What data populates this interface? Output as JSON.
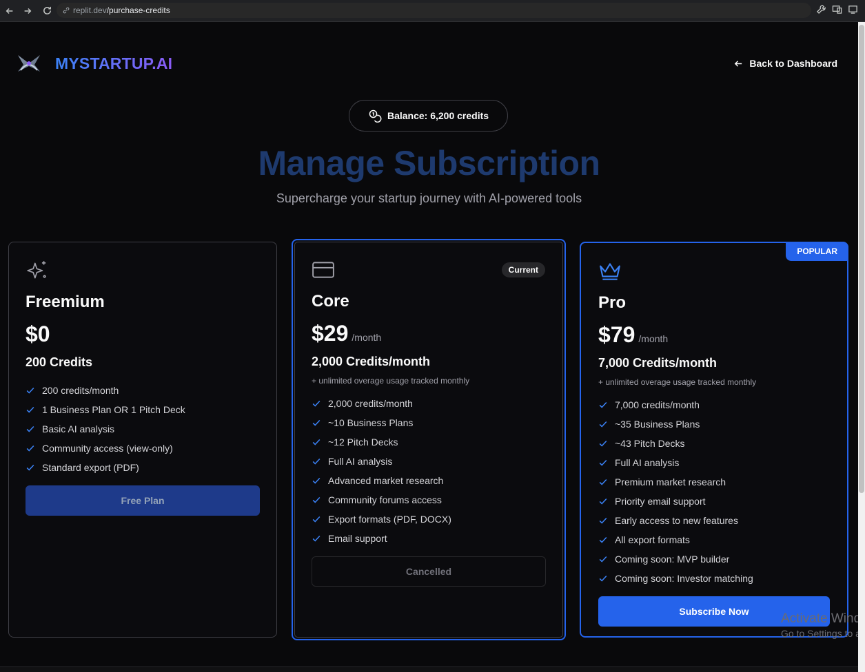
{
  "browser": {
    "url_host": "replit.dev",
    "url_path": "/purchase-credits"
  },
  "header": {
    "logo_text": "MYSTARTUP.AI",
    "back_label": "Back to Dashboard"
  },
  "balance": {
    "label": "Balance: 6,200 credits"
  },
  "hero": {
    "title": "Manage Subscription",
    "subtitle": "Supercharge your startup journey with AI-powered tools"
  },
  "plans": [
    {
      "name": "Freemium",
      "icon": "sparkles-icon",
      "price": "$0",
      "period": "",
      "credits": "200 Credits",
      "overage": "",
      "features": [
        "200 credits/month",
        "1 Business Plan OR 1 Pitch Deck",
        "Basic AI analysis",
        "Community access (view-only)",
        "Standard export (PDF)"
      ],
      "button": "Free Plan"
    },
    {
      "name": "Core",
      "icon": "credit-card-icon",
      "badge": "Current",
      "price": "$29",
      "period": "/month",
      "credits": "2,000 Credits/month",
      "overage": "+ unlimited overage usage tracked monthly",
      "features": [
        "2,000 credits/month",
        "~10 Business Plans",
        "~12 Pitch Decks",
        "Full AI analysis",
        "Advanced market research",
        "Community forums access",
        "Export formats (PDF, DOCX)",
        "Email support"
      ],
      "button": "Cancelled"
    },
    {
      "name": "Pro",
      "icon": "crown-icon",
      "badge": "POPULAR",
      "price": "$79",
      "period": "/month",
      "credits": "7,000 Credits/month",
      "overage": "+ unlimited overage usage tracked monthly",
      "features": [
        "7,000 credits/month",
        "~35 Business Plans",
        "~43 Pitch Decks",
        "Full AI analysis",
        "Premium market research",
        "Priority email support",
        "Early access to new features",
        "All export formats",
        "Coming soon: MVP builder",
        "Coming soon: Investor matching"
      ],
      "button": "Subscribe Now"
    }
  ],
  "watermark": {
    "title": "Activate Windows",
    "subtitle": "Go to Settings to activate Windows."
  },
  "colors": {
    "background": "#09090b",
    "accent": "#2563eb",
    "title": "#1e3a6e"
  }
}
